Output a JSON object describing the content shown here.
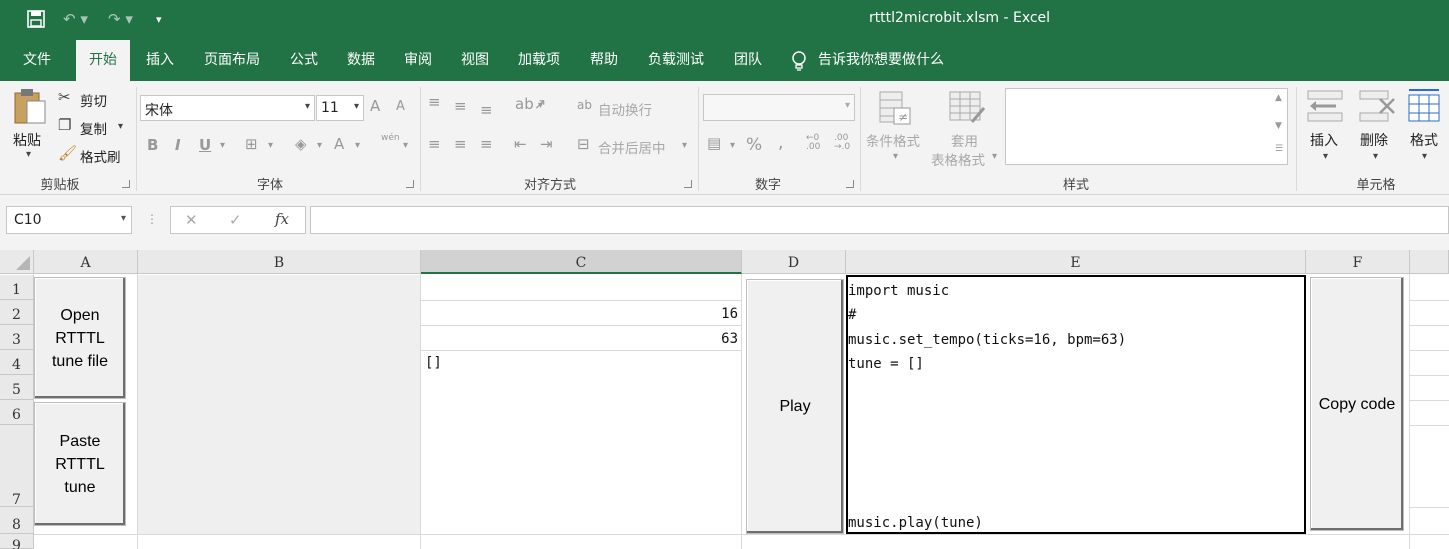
{
  "app": {
    "title": "rtttl2microbit.xlsm  -  Excel",
    "accent_color": "#217346"
  },
  "quick_access": {
    "save_icon": "save-icon",
    "undo_icon": "undo-icon",
    "redo_icon": "redo-icon",
    "customize_icon": "customize-icon"
  },
  "tabs": [
    "文件",
    "开始",
    "插入",
    "页面布局",
    "公式",
    "数据",
    "审阅",
    "视图",
    "加载项",
    "帮助",
    "负载测试",
    "团队"
  ],
  "active_tab": "开始",
  "tell_me": "告诉我你想要做什么",
  "ribbon": {
    "clipboard": {
      "paste": "粘贴",
      "cut": "剪切",
      "copy": "复制",
      "format_painter": "格式刷",
      "label": "剪贴板"
    },
    "font": {
      "family": "宋体",
      "size": "11",
      "bold": "B",
      "italic": "I",
      "underline": "U",
      "font_color_glyph": "A",
      "grow_glyph": "A",
      "shrink_glyph": "A",
      "phonetic_glyph": "wén",
      "label": "字体"
    },
    "alignment": {
      "wrap_text": "自动换行",
      "merge_center": "合并后居中",
      "label": "对齐方式"
    },
    "number": {
      "format": "",
      "percent": "%",
      "comma": ",",
      "label": "数字"
    },
    "styles": {
      "conditional_formatting": "条件格式",
      "format_as_table_line1": "套用",
      "format_as_table_line2": "表格格式",
      "label": "样式"
    },
    "cells": {
      "insert": "插入",
      "delete": "删除",
      "format": "格式",
      "label": "单元格"
    }
  },
  "formula_bar": {
    "name_box": "C10",
    "cancel_glyph": "✕",
    "enter_glyph": "✓",
    "fx_glyph": "fx",
    "formula": ""
  },
  "sheet": {
    "columns": [
      "A",
      "B",
      "C",
      "D",
      "E",
      "F"
    ],
    "selected_column": "C",
    "rows": [
      "1",
      "2",
      "3",
      "4",
      "5",
      "6",
      "7",
      "8",
      "9"
    ],
    "cells": {
      "C2": "16",
      "C3": "63",
      "C4": "[]"
    },
    "buttons": {
      "open": "Open\nRTTTL\ntune file",
      "paste": "Paste\nRTTTL\ntune",
      "play": "Play",
      "copy": "Copy code"
    },
    "code_lines": [
      "import music",
      "#",
      "music.set_tempo(ticks=16, bpm=63)",
      "tune = []",
      "music.play(tune)"
    ]
  }
}
